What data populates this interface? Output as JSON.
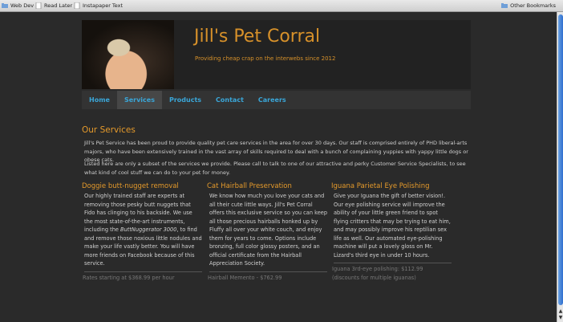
{
  "bookmarks": {
    "items": [
      {
        "label": "Web Dev"
      },
      {
        "label": "Read Later"
      },
      {
        "label": "Instapaper Text"
      }
    ],
    "other": "Other Bookmarks"
  },
  "site": {
    "title": "Jill's Pet Corral",
    "tagline": "Providing cheap crap on the interwebs since 2012"
  },
  "nav": [
    {
      "label": "Home"
    },
    {
      "label": "Services"
    },
    {
      "label": "Products"
    },
    {
      "label": "Contact"
    },
    {
      "label": "Careers"
    }
  ],
  "main": {
    "title": "Our Services",
    "intro": "Jill's Pet Service has been proud to provide quality pet care services in the area for over 30 days. Our staff is comprised entirely of PHD liberal-arts majors, who have been extensively trained in the vast array of skills required to deal with a bunch of complaining yuppies with yappy little dogs or obese cats.",
    "intro2": "Listed here are only a subset of the services we provide. Please call to talk to one of our attractive and perky Customer Service Specialists, to see what kind of cool stuff we can do to your pet for money.",
    "services": [
      {
        "title": "Doggie butt-nugget removal",
        "body_a": "Our highly trained staff are experts at removing those pesky butt nuggets that Fido has clinging to his backside. We use the most state-of-the-art instruments, including the ",
        "body_em": "ButtNuggerator 3000",
        "body_b": ", to find and remove those noxious little nodules and make your life vastly better. You will have more friends on Facebook because of this service.",
        "price": "Rates starting at $368.99 per hour"
      },
      {
        "title": "Cat Hairball Preservation",
        "body_a": "We know how much you love your cats and all their cute little ways. Jill's Pet Corral offers this exclusive service so you can keep all those precious hairballs honked up by Fluffy all over your white couch, and enjoy them for years to come. Options include bronzing, full color glossy posters, and an official certificate from the Hairball Appreciation Society.",
        "price": "Hairball Memento - $762.99"
      },
      {
        "title": "Iguana Parietal Eye Polishing",
        "body_a": "Give your Iguana the gift of better vision!. Our eye polishing service will improve the ability of your little green friend to spot flying critters that may be trying to eat him, and may possibly improve his reptilian sex life as well. Our automated eye-polishing machine will put a lovely gloss on Mr. Lizard's third eye in under 10 hours.",
        "price": "Iguana 3rd-eye polishing: $112.99 (discounts for multiple iguanas)"
      }
    ]
  }
}
